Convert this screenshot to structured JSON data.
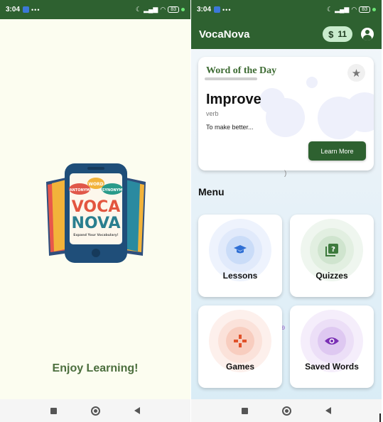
{
  "splash": {
    "status": {
      "time": "3:04",
      "battery": "83"
    },
    "logo": {
      "bubble_left": "ANTONYM",
      "bubble_center": "WORD",
      "bubble_right": "SYNONYM",
      "line1": "VOCA",
      "line2": "NOVA",
      "tagline": "Expand Your Vocabulary!"
    },
    "message": "Enjoy Learning!"
  },
  "home": {
    "status": {
      "time": "3:04",
      "battery": "83"
    },
    "appbar": {
      "title": "VocaNova",
      "coins": "11",
      "coin_symbol": "$"
    },
    "word_of_day": {
      "header": "Word of the Day",
      "word": "Improve",
      "part_of_speech": "verb",
      "definition": "To make better...",
      "button": "Learn More"
    },
    "menu": {
      "title": "Menu",
      "items": [
        {
          "label": "Lessons",
          "icon": "graduation-cap-icon",
          "color": "#2f6fd4"
        },
        {
          "label": "Quizzes",
          "icon": "quiz-icon",
          "color": "#3d7a3d"
        },
        {
          "label": "Games",
          "icon": "gamepad-icon",
          "color": "#e0512a"
        },
        {
          "label": "Saved Words",
          "icon": "eye-icon",
          "color": "#7a2fb5"
        }
      ]
    }
  }
}
